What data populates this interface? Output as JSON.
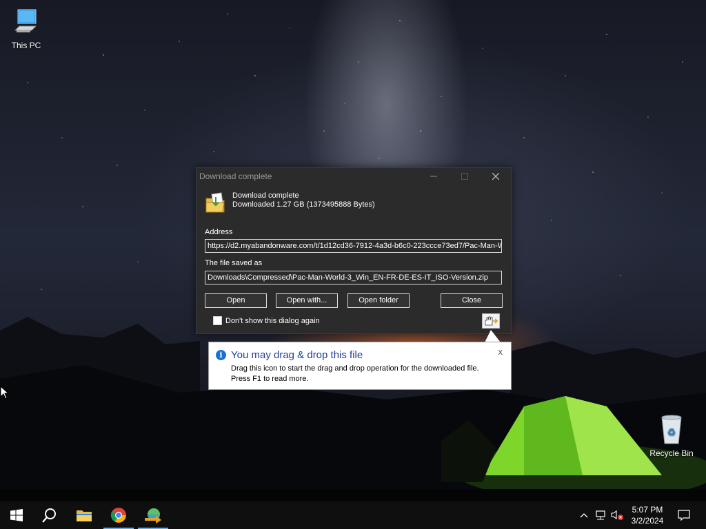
{
  "desktop": {
    "icons": [
      {
        "label": "This PC",
        "icon": "computer-icon"
      },
      {
        "label": "Recycle Bin",
        "icon": "recycle-bin-icon"
      }
    ]
  },
  "dialog": {
    "title": "Download complete",
    "heading": "Download complete",
    "subheading": "Downloaded 1.27  GB (1373495888 Bytes)",
    "address_label": "Address",
    "address_value": "https://d2.myabandonware.com/t/1d12cd36-7912-4a3d-b6c0-223ccce73ed7/Pac-Man-W",
    "saved_label": "The file saved as",
    "saved_value": "Downloads\\Compressed\\Pac-Man-World-3_Win_EN-FR-DE-ES-IT_ISO-Version.zip",
    "buttons": {
      "open": "Open",
      "open_with": "Open with...",
      "open_folder": "Open folder",
      "close": "Close"
    },
    "checkbox_label": "Don't show this dialog again",
    "checkbox_checked": false
  },
  "tooltip": {
    "title": "You may drag & drop this file",
    "line1": "Drag this icon to start the drag and drop operation for the downloaded file.",
    "line2": "Press F1 to read more.",
    "close": "x"
  },
  "taskbar": {
    "items": [
      "start-icon",
      "search-icon",
      "file-explorer-icon",
      "chrome-icon",
      "internet-download-manager-icon"
    ],
    "time": "5:07 PM",
    "date": "3/2/2024"
  },
  "colors": {
    "dialog_bg": "#2b2b2b",
    "tooltip_title": "#1c3f95",
    "info_blue": "#1a6fd4",
    "tent_green": "#7fd62a"
  }
}
